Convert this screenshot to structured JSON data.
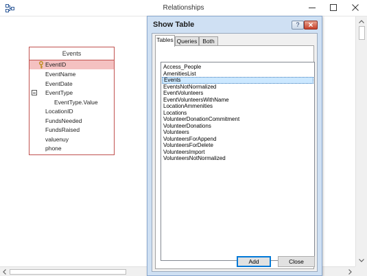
{
  "window": {
    "title": "Relationships"
  },
  "field_list": {
    "table_name": "Events",
    "fields": [
      {
        "label": "EventID",
        "primary_key": true,
        "selected": true
      },
      {
        "label": "EventName"
      },
      {
        "label": "EventDate"
      },
      {
        "label": "EventType",
        "expandable": true
      },
      {
        "label": "EventType.Value",
        "sub": true
      },
      {
        "label": "LocationID"
      },
      {
        "label": "FundsNeeded"
      },
      {
        "label": "FundsRaised"
      },
      {
        "label": "valuenuy"
      },
      {
        "label": "phone"
      }
    ]
  },
  "dialog": {
    "title": "Show Table",
    "help_label": "?",
    "tabs": [
      {
        "label": "Tables",
        "active": true
      },
      {
        "label": "Queries"
      },
      {
        "label": "Both"
      }
    ],
    "tables": [
      "Access_People",
      "AmenitiesList",
      "Events",
      "EventsNotNormalized",
      "EventVolunteers",
      "EventVolunteersWithName",
      "LocationAmmenities",
      "Locations",
      "VolunteerDonationCommitment",
      "VolunteerDonations",
      "Volunteers",
      "VolunteersForAppend",
      "VolunteersForDelete",
      "VolunteersImport",
      "VolunteersNotNormalized"
    ],
    "selected_table": "Events",
    "add_label": "Add",
    "close_label": "Close"
  },
  "colors": {
    "accent": "#0078d7",
    "selection_highlight": "#cce8ff",
    "field_list_border": "#c0504d",
    "dialog_frame": "#cfe0f3"
  }
}
